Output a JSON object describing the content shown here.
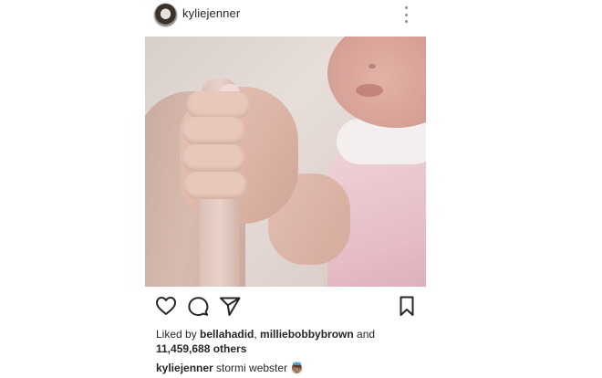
{
  "header": {
    "username": "kyliejenner",
    "avatar_icon": "profile-avatar",
    "more_icon": "more-vertical-icon"
  },
  "photo": {
    "subject": "baby-hand-holding-finger"
  },
  "actions": {
    "like_icon": "heart-icon",
    "comment_icon": "comment-icon",
    "share_icon": "send-icon",
    "save_icon": "bookmark-icon"
  },
  "likes": {
    "prefix": "Liked by ",
    "user1": "bellahadid",
    "separator": ", ",
    "user2": "milliebobbybrown",
    "conjunction": " and",
    "count": "11,459,688 others"
  },
  "caption": {
    "username": "kyliejenner",
    "text": "stormi webster",
    "emoji": "👼🏽"
  },
  "colors": {
    "text": "#262626",
    "muted": "#8e8e8e"
  }
}
